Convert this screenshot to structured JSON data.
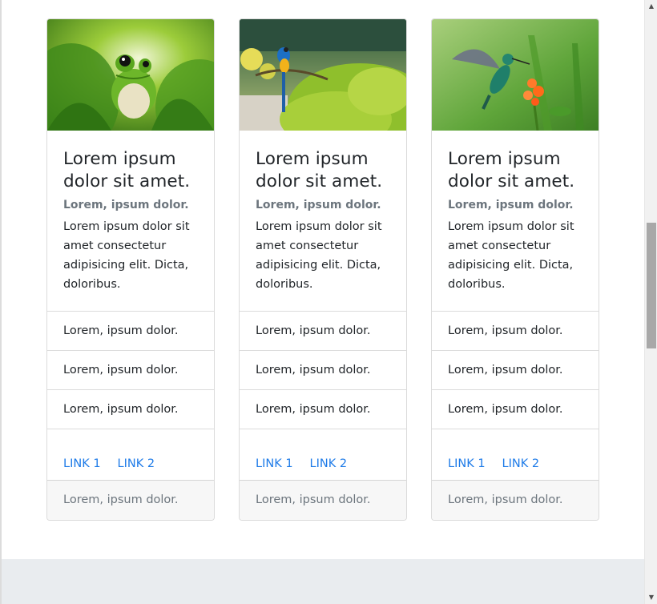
{
  "cards": [
    {
      "image": "frog-on-leaf",
      "title": "Lorem ipsum dolor sit amet.",
      "subtitle": "Lorem, ipsum dolor.",
      "text": "Lorem ipsum dolor sit amet consectetur adipisicing elit. Dicta, doloribus.",
      "list": [
        "Lorem, ipsum dolor.",
        "Lorem, ipsum dolor.",
        "Lorem, ipsum dolor."
      ],
      "link1": "LINK 1",
      "link2": "LINK 2",
      "footer": "Lorem, ipsum dolor."
    },
    {
      "image": "macaw-on-branch",
      "title": "Lorem ipsum dolor sit amet.",
      "subtitle": "Lorem, ipsum dolor.",
      "text": "Lorem ipsum dolor sit amet consectetur adipisicing elit. Dicta, doloribus.",
      "list": [
        "Lorem, ipsum dolor.",
        "Lorem, ipsum dolor.",
        "Lorem, ipsum dolor."
      ],
      "link1": "LINK 1",
      "link2": "LINK 2",
      "footer": "Lorem, ipsum dolor."
    },
    {
      "image": "hummingbird-at-flower",
      "title": "Lorem ipsum dolor sit amet.",
      "subtitle": "Lorem, ipsum dolor.",
      "text": "Lorem ipsum dolor sit amet consectetur adipisicing elit. Dicta, doloribus.",
      "list": [
        "Lorem, ipsum dolor.",
        "Lorem, ipsum dolor.",
        "Lorem, ipsum dolor."
      ],
      "link1": "LINK 1",
      "link2": "LINK 2",
      "footer": "Lorem, ipsum dolor."
    }
  ],
  "colors": {
    "link": "#1e7be8",
    "muted": "#6c757d",
    "footer_band": "#e9ecef"
  },
  "scrollbar": {
    "up_icon": "scroll-up-arrow-icon",
    "down_icon": "scroll-down-arrow-icon"
  }
}
